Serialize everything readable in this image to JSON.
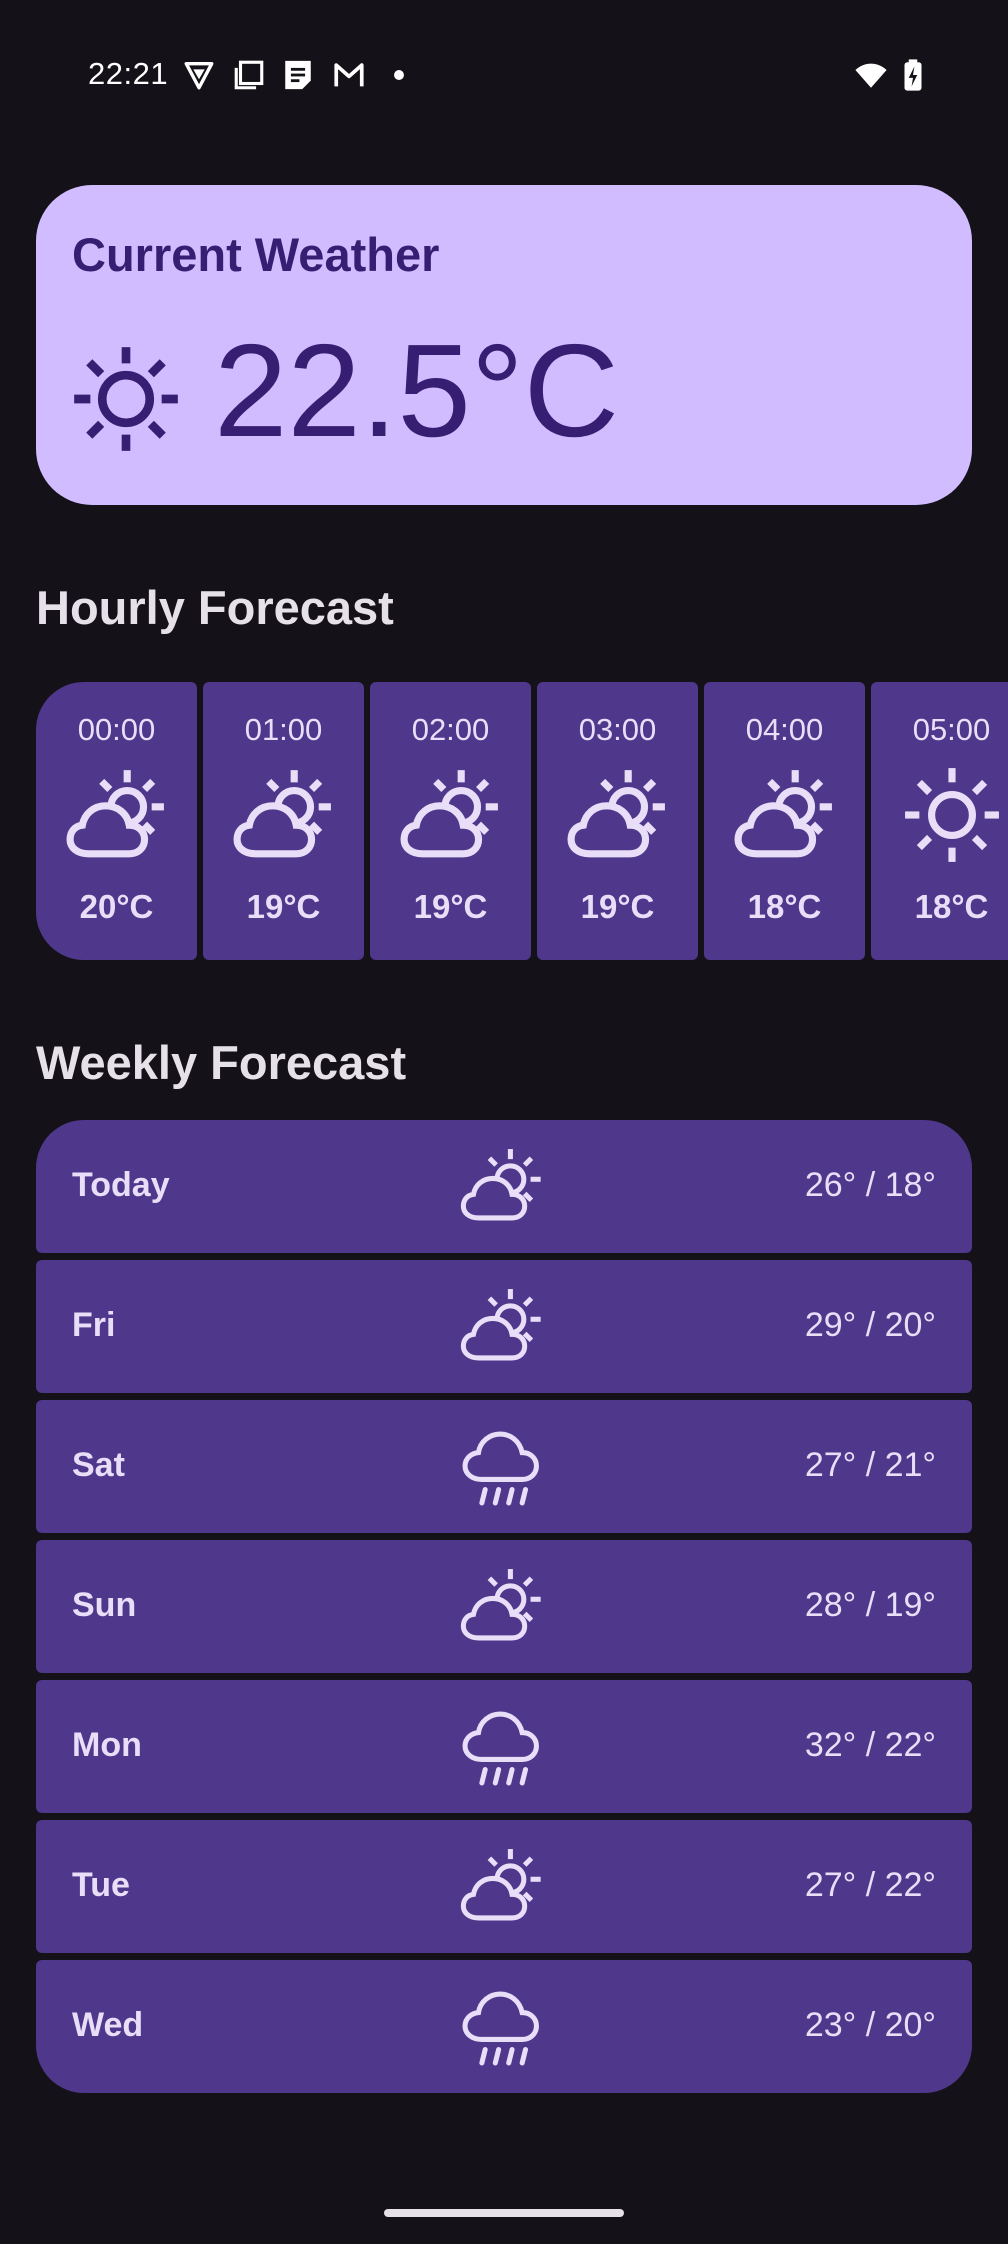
{
  "status_bar": {
    "time": "22:21",
    "icons": [
      "vpn-icon",
      "screenshot-icon",
      "notes-icon",
      "gmail-icon",
      "notification-dot-icon",
      "wifi-icon",
      "battery-charging-icon"
    ]
  },
  "current": {
    "title": "Current Weather",
    "temperature": "22.5°C",
    "icon": "sun-icon"
  },
  "hourly": {
    "title": "Hourly Forecast",
    "items": [
      {
        "time": "00:00",
        "temp": "20°C",
        "icon": "partly-cloudy-icon"
      },
      {
        "time": "01:00",
        "temp": "19°C",
        "icon": "partly-cloudy-icon"
      },
      {
        "time": "02:00",
        "temp": "19°C",
        "icon": "partly-cloudy-icon"
      },
      {
        "time": "03:00",
        "temp": "19°C",
        "icon": "partly-cloudy-icon"
      },
      {
        "time": "04:00",
        "temp": "18°C",
        "icon": "partly-cloudy-icon"
      },
      {
        "time": "05:00",
        "temp": "18°C",
        "icon": "sun-icon"
      }
    ]
  },
  "weekly": {
    "title": "Weekly Forecast",
    "days": [
      {
        "day": "Today",
        "temps": "26° / 18°",
        "icon": "partly-cloudy-icon"
      },
      {
        "day": "Fri",
        "temps": "29° / 20°",
        "icon": "partly-cloudy-icon"
      },
      {
        "day": "Sat",
        "temps": "27° / 21°",
        "icon": "rain-icon"
      },
      {
        "day": "Sun",
        "temps": "28° / 19°",
        "icon": "partly-cloudy-icon"
      },
      {
        "day": "Mon",
        "temps": "32° / 22°",
        "icon": "rain-icon"
      },
      {
        "day": "Tue",
        "temps": "27° / 22°",
        "icon": "partly-cloudy-icon"
      },
      {
        "day": "Wed",
        "temps": "23° / 20°",
        "icon": "rain-icon"
      }
    ]
  },
  "colors": {
    "background": "#141218",
    "primary_container": "#d0bcff",
    "on_primary_container": "#381e72",
    "card": "#4f378b",
    "on_card": "#e8def8"
  }
}
